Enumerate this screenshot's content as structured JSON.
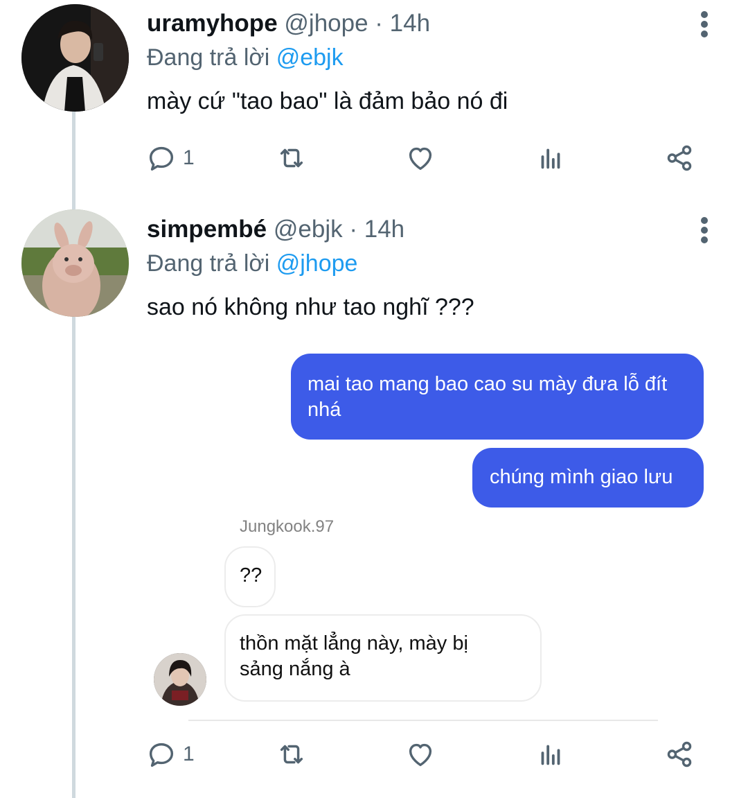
{
  "tweets": [
    {
      "display_name": "uramyhope",
      "handle": "@jhope",
      "time": "· 14h",
      "replying_prefix": "Đang trả lời",
      "replying_to": "@ebjk",
      "text": "mày cứ \"tao bao\" là đảm bảo nó đi",
      "reply_count": "1"
    },
    {
      "display_name": "simpembé",
      "handle": "@ebjk",
      "time": "· 14h",
      "replying_prefix": "Đang trả lời",
      "replying_to": "@jhope",
      "text": "sao nó không như tao nghĩ ???",
      "reply_count": "1",
      "media": {
        "sent_messages": [
          "mai tao mang bao cao su mày đưa lỗ đít nhá",
          "chúng mình giao lưu"
        ],
        "received_sender": "Jungkook.97",
        "received_messages": [
          "??",
          "thồn mặt lẳng này, mày bị sảng nắng à"
        ]
      }
    }
  ],
  "colors": {
    "mention": "#1d9bf0",
    "secondary_text": "#536471",
    "sent_bubble": "#3d5be8",
    "thread_line": "#cfd9de"
  },
  "icons": [
    "reply-icon",
    "retweet-icon",
    "like-icon",
    "views-icon",
    "share-icon",
    "more-icon"
  ]
}
